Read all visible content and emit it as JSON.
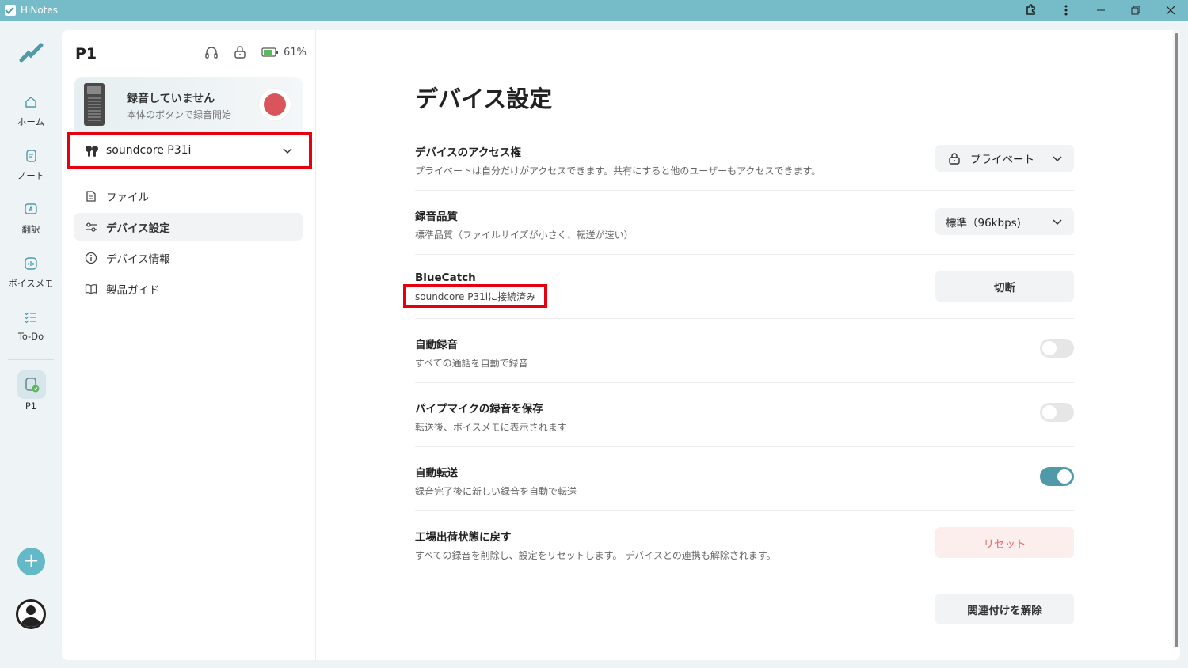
{
  "window": {
    "title": "HiNotes"
  },
  "rail": {
    "items": [
      {
        "label": "ホーム",
        "icon": "home-icon"
      },
      {
        "label": "ノート",
        "icon": "note-icon"
      },
      {
        "label": "翻訳",
        "icon": "translate-icon"
      },
      {
        "label": "ボイスメモ",
        "icon": "voice-memo-icon"
      },
      {
        "label": "To-Do",
        "icon": "todo-icon"
      }
    ],
    "device_label": "P1",
    "add_label": "+"
  },
  "device": {
    "name": "P1",
    "battery": "61%",
    "record_status": "録音していません",
    "record_hint": "本体のボタンで録音開始",
    "headset": "soundcore P31i"
  },
  "menu": [
    {
      "label": "ファイル",
      "icon": "file-icon"
    },
    {
      "label": "デバイス設定",
      "icon": "settings-sliders-icon",
      "active": true
    },
    {
      "label": "デバイス情報",
      "icon": "info-icon"
    },
    {
      "label": "製品ガイド",
      "icon": "book-icon"
    }
  ],
  "settings": {
    "title": "デバイス設定",
    "access": {
      "name": "デバイスのアクセス権",
      "desc": "プライベートは自分だけがアクセスできます。共有にすると他のユーザーもアクセスできます。",
      "value": "プライベート"
    },
    "quality": {
      "name": "録音品質",
      "desc": "標準品質（ファイルサイズが小さく、転送が速い）",
      "value": "標準（96kbps)"
    },
    "bluecatch": {
      "name": "BlueCatch",
      "desc": "soundcore P31iに接続済み",
      "button": "切断"
    },
    "auto_record": {
      "name": "自動録音",
      "desc": "すべての通話を自動で録音",
      "on": false
    },
    "pipe_mic": {
      "name": "パイプマイクの録音を保存",
      "desc": "転送後、ボイスメモに表示されます",
      "on": false
    },
    "auto_transfer": {
      "name": "自動転送",
      "desc": "録音完了後に新しい録音を自動で転送",
      "on": true
    },
    "factory_reset": {
      "name": "工場出荷状態に戻す",
      "desc": "すべての録音を削除し、設定をリセットします。 デバイスとの連携も解除されます。",
      "button": "リセット"
    },
    "unlink": {
      "button": "関連付けを解除"
    }
  },
  "colors": {
    "accent": "#63b9c6",
    "titlebar": "#75bcc8",
    "highlight": "#e6000f",
    "record": "#d9545b",
    "toggle_on": "#4f99a8"
  }
}
